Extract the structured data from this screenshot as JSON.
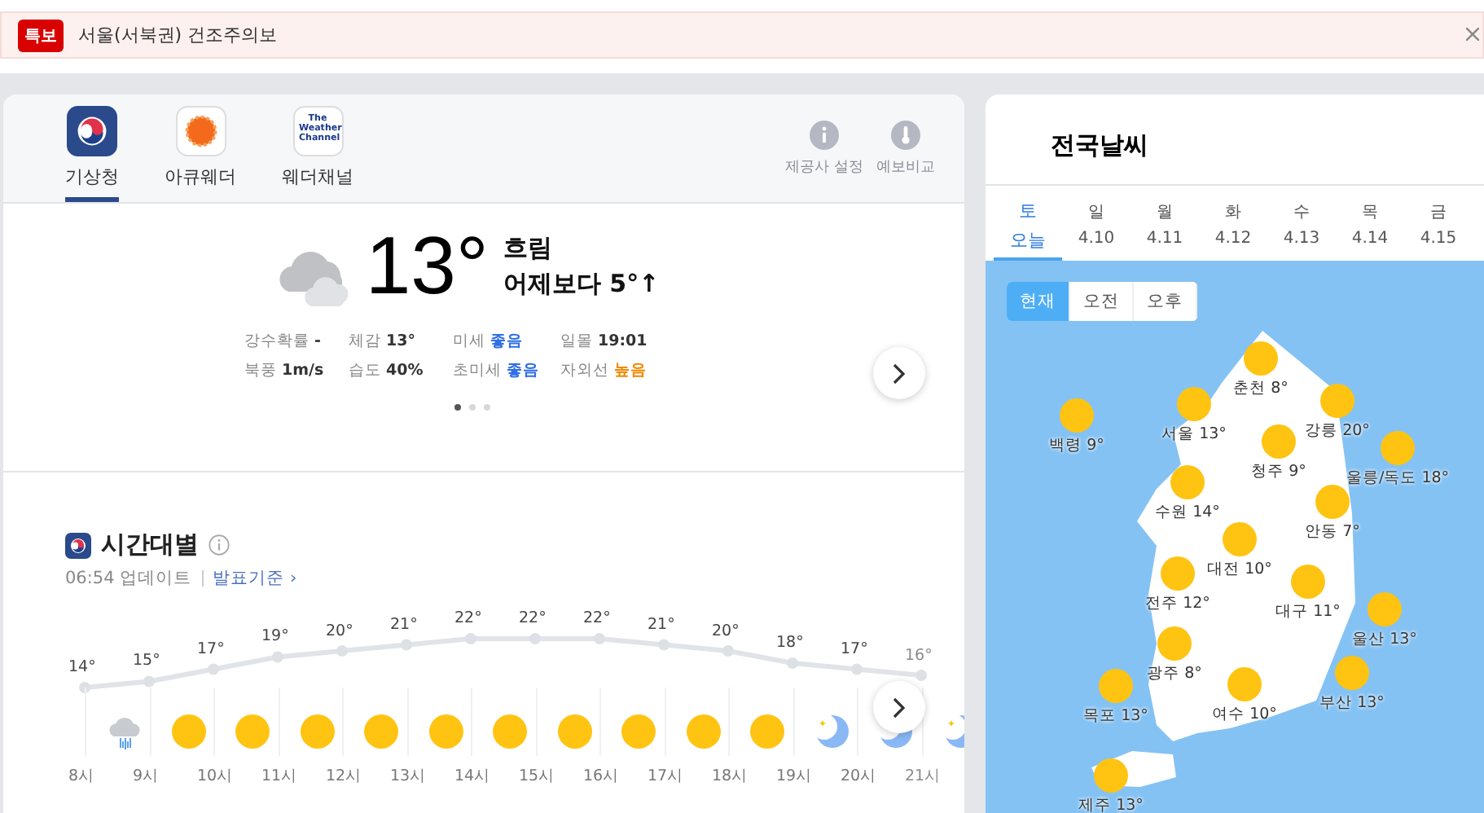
{
  "alert": {
    "badge": "특보",
    "text": "서울(서북권) 건조주의보"
  },
  "providers": [
    {
      "label": "기상청",
      "kind": "emblem",
      "selected": true
    },
    {
      "label": "아큐웨더",
      "kind": "sunburst",
      "selected": false
    },
    {
      "label": "웨더채널",
      "kind": "wordmark",
      "logo_text": "The Weather Channel",
      "selected": false
    }
  ],
  "tools": [
    {
      "label": "제공사 설정",
      "kind": "info"
    },
    {
      "label": "예보비교",
      "kind": "gauge"
    }
  ],
  "current": {
    "temp": "13°",
    "condition": "흐림",
    "compare": "어제보다 5°↑",
    "stats": [
      {
        "label": "강수확률",
        "value": "-",
        "kind": "plain"
      },
      {
        "label": "체감",
        "value": "13°",
        "kind": "plain"
      },
      {
        "label": "미세",
        "value": "좋음",
        "kind": "good"
      },
      {
        "label": "일몰",
        "value": "19:01",
        "kind": "plain"
      },
      {
        "label": "북풍",
        "value": "1m/s",
        "kind": "plain"
      },
      {
        "label": "습도",
        "value": "40%",
        "kind": "plain"
      },
      {
        "label": "초미세",
        "value": "좋음",
        "kind": "good"
      },
      {
        "label": "자외선",
        "value": "높음",
        "kind": "warn"
      }
    ],
    "pages": [
      {
        "selected": true
      },
      {
        "selected": false
      },
      {
        "selected": false
      }
    ]
  },
  "hourly": {
    "title": "시간대별",
    "updated": "06:54 업데이트",
    "basis": "발표기준 ›",
    "hours": [
      {
        "temp": "14°",
        "kind": "rain",
        "time": "8시"
      },
      {
        "temp": "15°",
        "kind": "sun",
        "time": "9시"
      },
      {
        "temp": "17°",
        "kind": "sun",
        "time": "10시"
      },
      {
        "temp": "19°",
        "kind": "sun",
        "time": "11시"
      },
      {
        "temp": "20°",
        "kind": "sun",
        "time": "12시"
      },
      {
        "temp": "21°",
        "kind": "sun",
        "time": "13시"
      },
      {
        "temp": "22°",
        "kind": "sun",
        "time": "14시"
      },
      {
        "temp": "22°",
        "kind": "sun",
        "time": "15시"
      },
      {
        "temp": "22°",
        "kind": "sun",
        "time": "16시"
      },
      {
        "temp": "21°",
        "kind": "sun",
        "time": "17시"
      },
      {
        "temp": "20°",
        "kind": "sun",
        "time": "18시"
      },
      {
        "temp": "18°",
        "kind": "moon",
        "time": "19시"
      },
      {
        "temp": "17°",
        "kind": "moon",
        "time": "20시"
      },
      {
        "temp": "16°",
        "kind": "moon",
        "time": "21시"
      }
    ]
  },
  "national": {
    "title": "전국날씨",
    "days": [
      {
        "day": "토",
        "date": "오늘",
        "selected": true
      },
      {
        "day": "일",
        "date": "4.10",
        "selected": false
      },
      {
        "day": "월",
        "date": "4.11",
        "selected": false
      },
      {
        "day": "화",
        "date": "4.12",
        "selected": false
      },
      {
        "day": "수",
        "date": "4.13",
        "selected": false
      },
      {
        "day": "목",
        "date": "4.14",
        "selected": false
      },
      {
        "day": "금",
        "date": "4.15",
        "selected": false
      }
    ],
    "periods": [
      {
        "label": "현재",
        "selected": true
      },
      {
        "label": "오전",
        "selected": false
      },
      {
        "label": "오후",
        "selected": false
      }
    ],
    "cities": [
      {
        "name": "백령 9°"
      },
      {
        "name": "서울 13°"
      },
      {
        "name": "춘천 8°"
      },
      {
        "name": "강릉 20°"
      },
      {
        "name": "울릉/독도 18°"
      },
      {
        "name": "청주 9°"
      },
      {
        "name": "수원 14°"
      },
      {
        "name": "안동 7°"
      },
      {
        "name": "대전 10°"
      },
      {
        "name": "전주 12°"
      },
      {
        "name": "대구 11°"
      },
      {
        "name": "울산 13°"
      },
      {
        "name": "광주 8°"
      },
      {
        "name": "부산 13°"
      },
      {
        "name": "목포 13°"
      },
      {
        "name": "여수 10°"
      },
      {
        "name": "제주 13°"
      }
    ]
  }
}
